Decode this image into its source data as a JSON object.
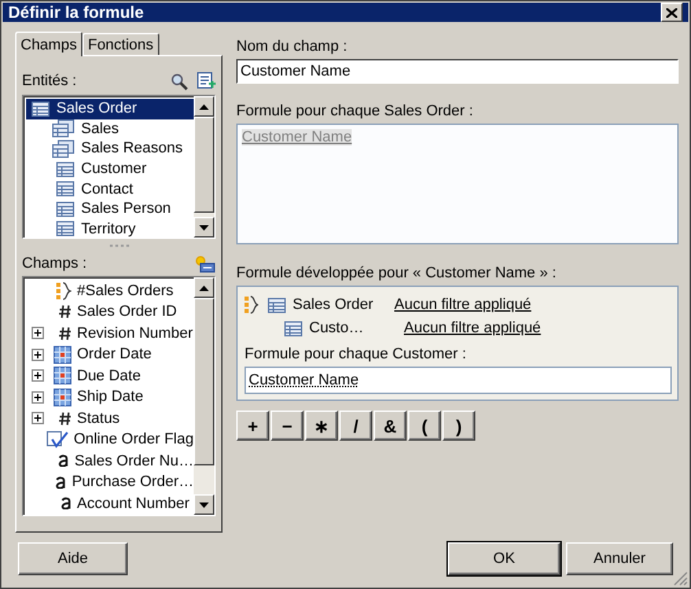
{
  "window": {
    "title": "Définir la formule"
  },
  "tabs": [
    {
      "label": "Champs",
      "selected": true
    },
    {
      "label": "Fonctions",
      "selected": false
    }
  ],
  "entities": {
    "label": "Entités :",
    "items": [
      {
        "label": "Sales Order",
        "kind": "table",
        "selected": true
      },
      {
        "label": "Sales",
        "kind": "tables",
        "selected": false
      },
      {
        "label": "Sales Reasons",
        "kind": "tables",
        "selected": false
      },
      {
        "label": "Customer",
        "kind": "table",
        "selected": false
      },
      {
        "label": "Contact",
        "kind": "table",
        "selected": false
      },
      {
        "label": "Sales Person",
        "kind": "table",
        "selected": false
      },
      {
        "label": "Territory",
        "kind": "table",
        "selected": false
      }
    ]
  },
  "fields": {
    "label": "Champs :",
    "items": [
      {
        "label": "#Sales Orders",
        "kind": "aggregate",
        "expandable": false
      },
      {
        "label": "Sales Order ID",
        "kind": "number",
        "expandable": false
      },
      {
        "label": "Revision Number",
        "kind": "number",
        "expandable": true
      },
      {
        "label": "Order Date",
        "kind": "date",
        "expandable": true
      },
      {
        "label": "Due Date",
        "kind": "date",
        "expandable": true
      },
      {
        "label": "Ship Date",
        "kind": "date",
        "expandable": true
      },
      {
        "label": "Status",
        "kind": "number",
        "expandable": true
      },
      {
        "label": "Online Order Flag",
        "kind": "boolean",
        "expandable": false
      },
      {
        "label": "Sales Order Nu…",
        "kind": "text",
        "expandable": false
      },
      {
        "label": "Purchase Order…",
        "kind": "text",
        "expandable": false
      },
      {
        "label": "Account Number",
        "kind": "text",
        "expandable": false
      }
    ]
  },
  "help_button": "Aide",
  "field_name": {
    "label": "Nom du champ :",
    "value": "Customer Name"
  },
  "formula": {
    "label": "Formule pour chaque Sales Order :",
    "value": "Customer Name"
  },
  "expanded": {
    "label": "Formule développée pour « Customer Name » :",
    "rows": [
      {
        "entity": "Sales Order",
        "filter": "Aucun filtre appliqué",
        "children": [
          {
            "entity": "Custo…",
            "filter": "Aucun filtre appliqué"
          }
        ]
      }
    ],
    "sub_label": "Formule pour chaque Customer :",
    "sub_value": "Customer Name"
  },
  "operators": [
    "+",
    "−",
    "∗",
    "/",
    "&",
    "(",
    ")"
  ],
  "buttons": {
    "ok": "OK",
    "cancel": "Annuler"
  }
}
